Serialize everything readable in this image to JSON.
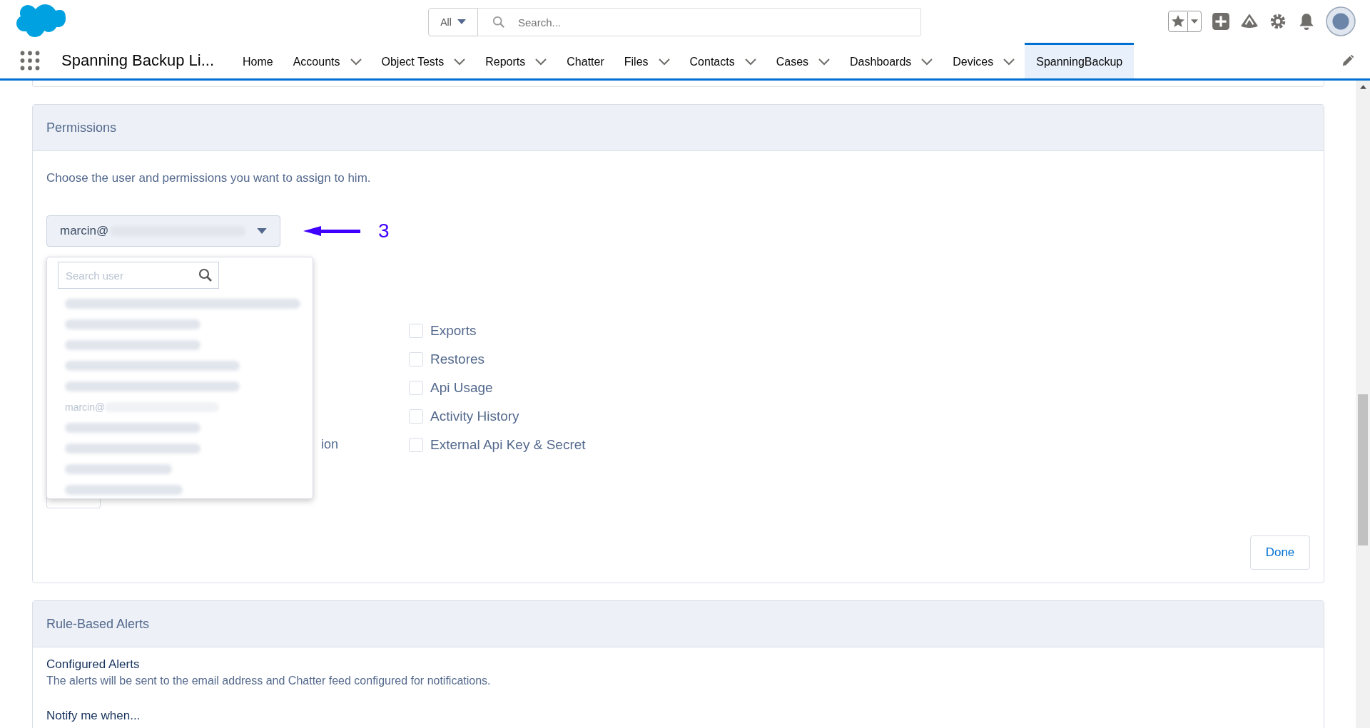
{
  "header": {
    "search_scope": "All",
    "search": {
      "placeholder": "Search..."
    }
  },
  "nav": {
    "app_name": "Spanning Backup Li...",
    "tabs": [
      {
        "label": "Home",
        "has_menu": false,
        "selected": false
      },
      {
        "label": "Accounts",
        "has_menu": true,
        "selected": false
      },
      {
        "label": "Object Tests",
        "has_menu": true,
        "selected": false
      },
      {
        "label": "Reports",
        "has_menu": true,
        "selected": false
      },
      {
        "label": "Chatter",
        "has_menu": false,
        "selected": false
      },
      {
        "label": "Files",
        "has_menu": true,
        "selected": false
      },
      {
        "label": "Contacts",
        "has_menu": true,
        "selected": false
      },
      {
        "label": "Cases",
        "has_menu": true,
        "selected": false
      },
      {
        "label": "Dashboards",
        "has_menu": true,
        "selected": false
      },
      {
        "label": "Devices",
        "has_menu": true,
        "selected": false
      },
      {
        "label": "SpanningBackup",
        "has_menu": false,
        "selected": true
      }
    ]
  },
  "permissions": {
    "title": "Permissions",
    "description": "Choose the user and permissions you want to assign to him.",
    "user_select": {
      "value": "marcin@",
      "redacted": true
    },
    "annotation": {
      "label": "3"
    },
    "user_dropdown": {
      "search": {
        "placeholder": "Search user"
      },
      "items": [
        {
          "kind": "redacted"
        },
        {
          "kind": "redacted"
        },
        {
          "kind": "redacted"
        },
        {
          "kind": "redacted"
        },
        {
          "kind": "redacted"
        },
        {
          "kind": "partial",
          "label": "marcin@"
        },
        {
          "kind": "redacted"
        },
        {
          "kind": "redacted"
        },
        {
          "kind": "redacted"
        },
        {
          "kind": "redacted"
        }
      ]
    },
    "left_column": {
      "visible_text": "ion"
    },
    "permissions": [
      {
        "label": "Exports",
        "checked": false
      },
      {
        "label": "Restores",
        "checked": false
      },
      {
        "label": "Api Usage",
        "checked": false
      },
      {
        "label": "Activity History",
        "checked": false
      },
      {
        "label": "External Api Key & Secret",
        "checked": false
      }
    ],
    "done_button": "Done"
  },
  "rule_based_alerts": {
    "title": "Rule-Based Alerts",
    "subtitle": "Configured Alerts",
    "description": "The alerts will be sent to the email address and Chatter feed configured for notifications.",
    "notify_label": "Notify me when..."
  }
}
